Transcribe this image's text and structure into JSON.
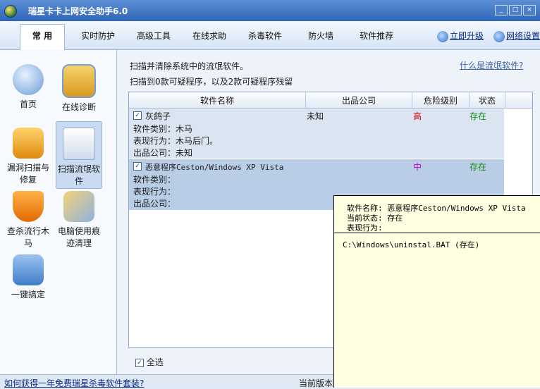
{
  "window": {
    "title": "瑞星卡卡上网安全助手6.0",
    "buttons": [
      "_",
      "□",
      "×"
    ]
  },
  "menu": {
    "tabs": [
      "常 用",
      "实时防护",
      "高级工具",
      "在线求助",
      "杀毒软件",
      "防火墙",
      "软件推荐"
    ],
    "active_tab": "常 用",
    "links": {
      "upgrade": "立即升级",
      "network": "网络设置"
    }
  },
  "sidebar": {
    "items": [
      {
        "label": "首页",
        "icon": "home-icon"
      },
      {
        "label": "在线诊断",
        "icon": "diagnose-icon"
      },
      {
        "label": "漏洞扫描与修复",
        "icon": "patch-box-icon"
      },
      {
        "label": "扫描流氓软件",
        "icon": "warning-window-icon"
      },
      {
        "label": "查杀流行木马",
        "icon": "trojan-shield-icon"
      },
      {
        "label": "电脑使用痕迹清理",
        "icon": "broom-icon"
      },
      {
        "label": "一键搞定",
        "icon": "one-click-icon"
      }
    ],
    "selected": "扫描流氓软件"
  },
  "main": {
    "info_line1": "扫描并清除系统中的流氓软件。",
    "info_line2": "扫描到0款可疑程序，以及2款可疑程序残留",
    "what_link": "什么是流氓软件?",
    "columns": [
      "软件名称",
      "出品公司",
      "危险级别",
      "状态"
    ],
    "rows": [
      {
        "name": "灰鸽子",
        "company": "未知",
        "level": "高",
        "status": "存在",
        "type_label": "软件类别：",
        "type_value": "木马",
        "behavior_label": "表现行为：",
        "behavior_value": "木马后门。",
        "publisher_label": "出品公司：",
        "publisher_value": "未知"
      },
      {
        "name": "恶意程序Ceston/Windows XP Vista",
        "company": "",
        "level": "中",
        "status": "存在",
        "type_label": "软件类别：",
        "type_value": "",
        "behavior_label": "表现行为：",
        "behavior_value": "",
        "publisher_label": "出品公司：",
        "publisher_value": ""
      }
    ],
    "select_all": "全选"
  },
  "tooltip": {
    "name_line": "软件名称: 恶意程序Ceston/Windows XP Vista",
    "state_line": "当前状态: 存在",
    "behavior_line": "表现行为:",
    "path_line": "C:\\Windows\\uninstal.BAT  (存在)"
  },
  "statusbar": {
    "left_link": "如何获得一年免费瑞星杀毒软件套装?",
    "right": "当前版本"
  }
}
